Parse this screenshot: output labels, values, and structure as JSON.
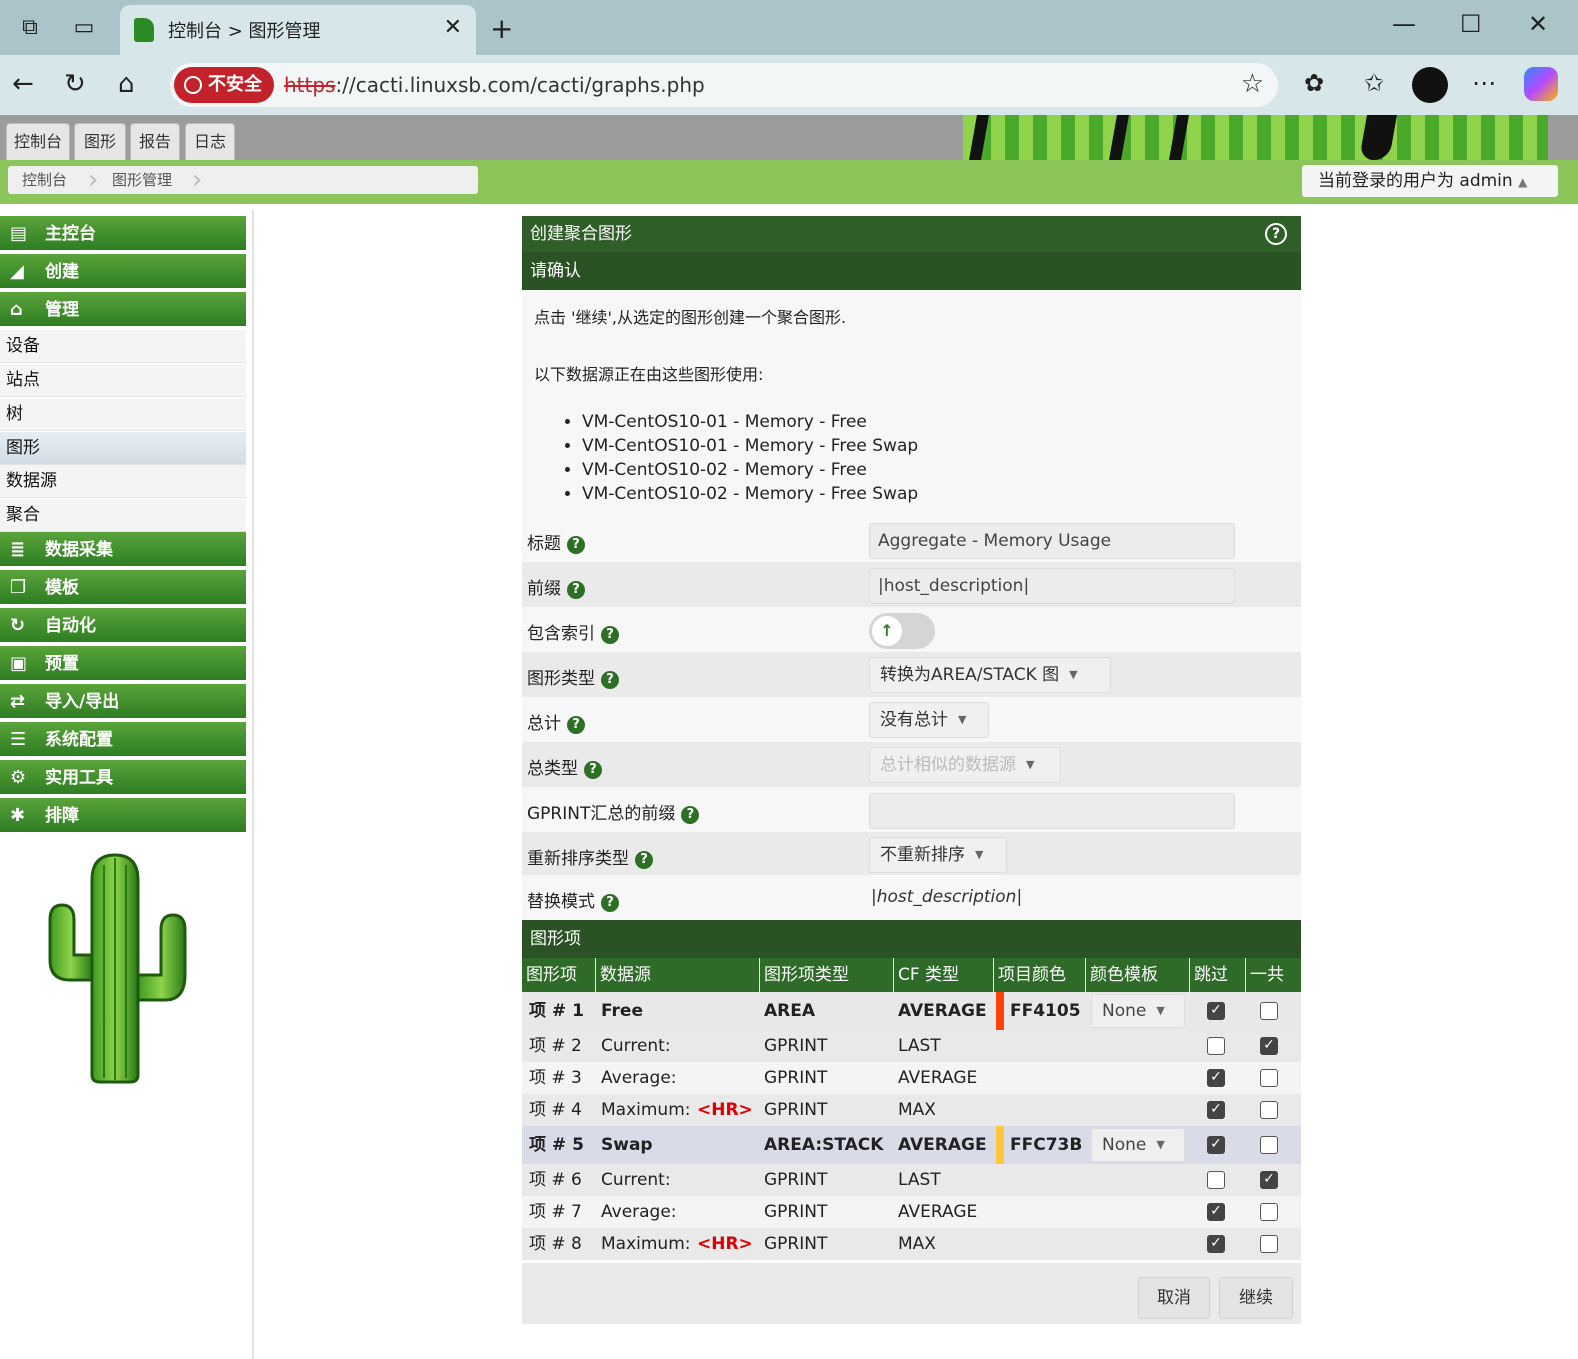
{
  "browser": {
    "tab_title": "控制台 > 图形管理",
    "insecure_label": "不安全",
    "url_scheme": "https",
    "url_rest": "://cacti.linuxsb.com/cacti/graphs.php"
  },
  "cacti": {
    "main_tabs": [
      "控制台",
      "图形",
      "报告",
      "日志"
    ],
    "breadcrumbs": [
      "控制台",
      "图形管理"
    ],
    "user_label": "当前登录的用户为 admin"
  },
  "sidebar": {
    "headers_top": [
      {
        "label": "主控台",
        "icon": "map-icon"
      },
      {
        "label": "创建",
        "icon": "area-chart-icon"
      },
      {
        "label": "管理",
        "icon": "home-icon"
      }
    ],
    "sub_items": [
      "设备",
      "站点",
      "树",
      "图形",
      "数据源",
      "聚合"
    ],
    "selected_sub": "图形",
    "headers_bottom": [
      {
        "label": "数据采集",
        "icon": "database-icon"
      },
      {
        "label": "模板",
        "icon": "copy-icon"
      },
      {
        "label": "自动化",
        "icon": "refresh-icon"
      },
      {
        "label": "预置",
        "icon": "archive-icon"
      },
      {
        "label": "导入/导出",
        "icon": "exchange-icon"
      },
      {
        "label": "系统配置",
        "icon": "sliders-icon"
      },
      {
        "label": "实用工具",
        "icon": "cogs-icon"
      },
      {
        "label": "排障",
        "icon": "bug-icon"
      }
    ]
  },
  "panel": {
    "title": "创建聚合图形",
    "confirm_header": "请确认",
    "intro": "点击 '继续',从选定的图形创建一个聚合图形.",
    "ds_intro": "以下数据源正在由这些图形使用:",
    "data_sources": [
      "VM-CentOS10-01 - Memory - Free",
      "VM-CentOS10-01 - Memory - Free Swap",
      "VM-CentOS10-02 - Memory - Free",
      "VM-CentOS10-02 - Memory - Free Swap"
    ],
    "fields": {
      "title_label": "标题",
      "title_value": "Aggregate - Memory Usage",
      "prefix_label": "前缀",
      "prefix_value": "|host_description|",
      "include_index_label": "包含索引",
      "graph_type_label": "图形类型",
      "graph_type_value": "转换为AREA/STACK 图",
      "total_label": "总计",
      "total_value": "没有总计",
      "total_type_label": "总类型",
      "total_type_value": "总计相似的数据源",
      "gprint_prefix_label": "GPRINT汇总的前缀",
      "gprint_prefix_value": "",
      "reorder_label": "重新排序类型",
      "reorder_value": "不重新排序",
      "replace_label": "替换模式",
      "replace_value": "|host_description|"
    },
    "items_header": "图形项",
    "table_headers": [
      "图形项",
      "数据源",
      "图形项类型",
      "CF 类型",
      "项目颜色",
      "颜色模板",
      "跳过",
      "一共"
    ],
    "rows": [
      {
        "item": "项 # 1",
        "source": "Free",
        "hr": "",
        "type": "AREA",
        "cf": "AVERAGE",
        "color": "FF4105",
        "color_hex": "#FF4105",
        "template": "None",
        "skip": true,
        "total": false
      },
      {
        "item": "项 # 2",
        "source": "Current:",
        "hr": "",
        "type": "GPRINT",
        "cf": "LAST",
        "color": "",
        "color_hex": "",
        "template": "",
        "skip": false,
        "total": true
      },
      {
        "item": "项 # 3",
        "source": "Average:",
        "hr": "",
        "type": "GPRINT",
        "cf": "AVERAGE",
        "color": "",
        "color_hex": "",
        "template": "",
        "skip": true,
        "total": false
      },
      {
        "item": "项 # 4",
        "source": "Maximum:",
        "hr": "<HR>",
        "type": "GPRINT",
        "cf": "MAX",
        "color": "",
        "color_hex": "",
        "template": "",
        "skip": true,
        "total": false
      },
      {
        "item": "项 # 5",
        "source": "Swap",
        "hr": "",
        "type": "AREA:STACK",
        "cf": "AVERAGE",
        "color": "FFC73B",
        "color_hex": "#FFC73B",
        "template": "None",
        "skip": true,
        "total": false
      },
      {
        "item": "项 # 6",
        "source": "Current:",
        "hr": "",
        "type": "GPRINT",
        "cf": "LAST",
        "color": "",
        "color_hex": "",
        "template": "",
        "skip": false,
        "total": true
      },
      {
        "item": "项 # 7",
        "source": "Average:",
        "hr": "",
        "type": "GPRINT",
        "cf": "AVERAGE",
        "color": "",
        "color_hex": "",
        "template": "",
        "skip": true,
        "total": false
      },
      {
        "item": "项 # 8",
        "source": "Maximum:",
        "hr": "<HR>",
        "type": "GPRINT",
        "cf": "MAX",
        "color": "",
        "color_hex": "",
        "template": "",
        "skip": true,
        "total": false
      }
    ],
    "cancel_label": "取消",
    "continue_label": "继续"
  }
}
